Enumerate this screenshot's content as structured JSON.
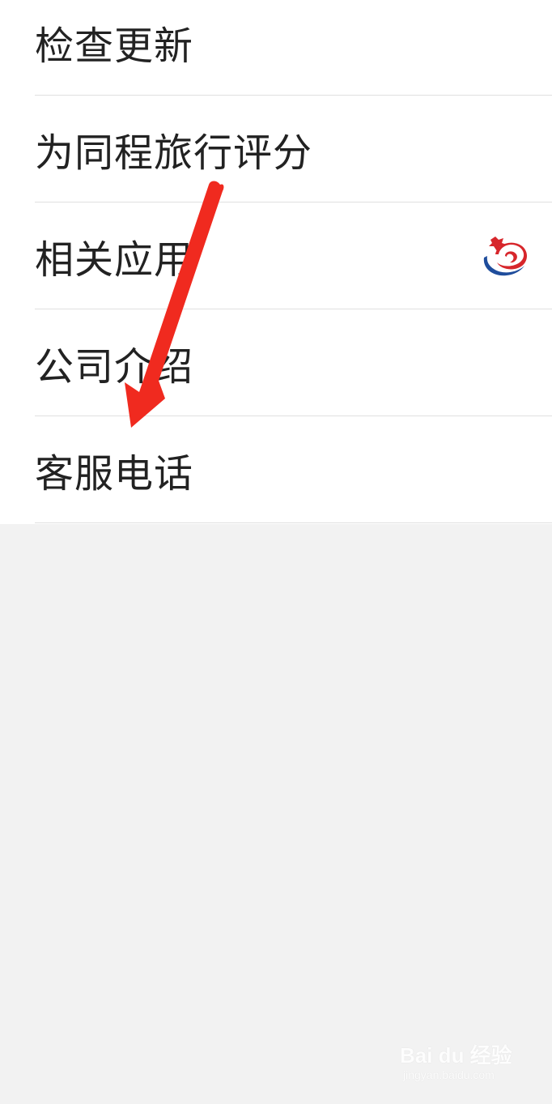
{
  "menu": {
    "items": [
      {
        "label": "检查更新"
      },
      {
        "label": "为同程旅行评分"
      },
      {
        "label": "相关应用",
        "trailing_icon": "tongcheng-app-logo"
      },
      {
        "label": "公司介绍"
      },
      {
        "label": "客服电话"
      }
    ]
  },
  "annotation": {
    "type": "arrow",
    "color": "#f02a1f",
    "points_to": "客服电话"
  },
  "watermark": {
    "logo_text": "Bai du 经验",
    "url": "jingyan.baidu.com"
  },
  "colors": {
    "background": "#f2f2f2",
    "panel": "#ffffff",
    "text": "#222222",
    "divider": "#e0e0e0",
    "logo_red": "#d7262b",
    "logo_blue": "#1f4d9c"
  }
}
